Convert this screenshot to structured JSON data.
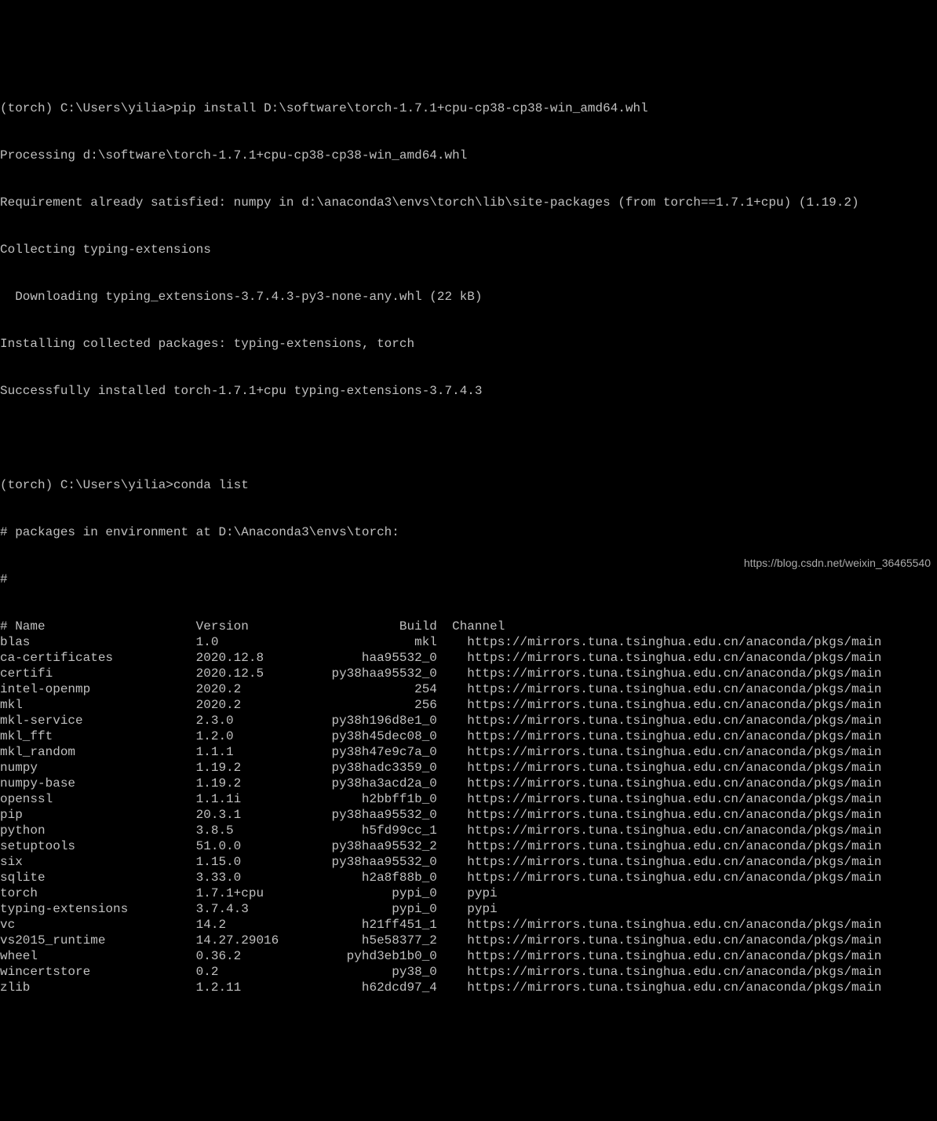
{
  "pip_install": {
    "prompt": "(torch) C:\\Users\\yilia>",
    "command": "pip install D:\\software\\torch-1.7.1+cpu-cp38-cp38-win_amd64.whl",
    "lines": [
      "Processing d:\\software\\torch-1.7.1+cpu-cp38-cp38-win_amd64.whl",
      "Requirement already satisfied: numpy in d:\\anaconda3\\envs\\torch\\lib\\site-packages (from torch==1.7.1+cpu) (1.19.2)",
      "Collecting typing-extensions",
      "  Downloading typing_extensions-3.7.4.3-py3-none-any.whl (22 kB)",
      "Installing collected packages: typing-extensions, torch",
      "Successfully installed torch-1.7.1+cpu typing-extensions-3.7.4.3"
    ]
  },
  "conda_list": {
    "prompt": "(torch) C:\\Users\\yilia>",
    "command": "conda list",
    "header_lines": [
      "# packages in environment at D:\\Anaconda3\\envs\\torch:",
      "#"
    ],
    "columns": {
      "name": "# Name",
      "version": "Version",
      "build": "Build",
      "channel": "Channel"
    },
    "packages": [
      {
        "name": "blas",
        "version": "1.0",
        "build": "mkl",
        "channel": "https://mirrors.tuna.tsinghua.edu.cn/anaconda/pkgs/main"
      },
      {
        "name": "ca-certificates",
        "version": "2020.12.8",
        "build": "haa95532_0",
        "channel": "https://mirrors.tuna.tsinghua.edu.cn/anaconda/pkgs/main"
      },
      {
        "name": "certifi",
        "version": "2020.12.5",
        "build": "py38haa95532_0",
        "channel": "https://mirrors.tuna.tsinghua.edu.cn/anaconda/pkgs/main"
      },
      {
        "name": "intel-openmp",
        "version": "2020.2",
        "build": "254",
        "channel": "https://mirrors.tuna.tsinghua.edu.cn/anaconda/pkgs/main"
      },
      {
        "name": "mkl",
        "version": "2020.2",
        "build": "256",
        "channel": "https://mirrors.tuna.tsinghua.edu.cn/anaconda/pkgs/main"
      },
      {
        "name": "mkl-service",
        "version": "2.3.0",
        "build": "py38h196d8e1_0",
        "channel": "https://mirrors.tuna.tsinghua.edu.cn/anaconda/pkgs/main"
      },
      {
        "name": "mkl_fft",
        "version": "1.2.0",
        "build": "py38h45dec08_0",
        "channel": "https://mirrors.tuna.tsinghua.edu.cn/anaconda/pkgs/main"
      },
      {
        "name": "mkl_random",
        "version": "1.1.1",
        "build": "py38h47e9c7a_0",
        "channel": "https://mirrors.tuna.tsinghua.edu.cn/anaconda/pkgs/main"
      },
      {
        "name": "numpy",
        "version": "1.19.2",
        "build": "py38hadc3359_0",
        "channel": "https://mirrors.tuna.tsinghua.edu.cn/anaconda/pkgs/main"
      },
      {
        "name": "numpy-base",
        "version": "1.19.2",
        "build": "py38ha3acd2a_0",
        "channel": "https://mirrors.tuna.tsinghua.edu.cn/anaconda/pkgs/main"
      },
      {
        "name": "openssl",
        "version": "1.1.1i",
        "build": "h2bbff1b_0",
        "channel": "https://mirrors.tuna.tsinghua.edu.cn/anaconda/pkgs/main"
      },
      {
        "name": "pip",
        "version": "20.3.1",
        "build": "py38haa95532_0",
        "channel": "https://mirrors.tuna.tsinghua.edu.cn/anaconda/pkgs/main"
      },
      {
        "name": "python",
        "version": "3.8.5",
        "build": "h5fd99cc_1",
        "channel": "https://mirrors.tuna.tsinghua.edu.cn/anaconda/pkgs/main"
      },
      {
        "name": "setuptools",
        "version": "51.0.0",
        "build": "py38haa95532_2",
        "channel": "https://mirrors.tuna.tsinghua.edu.cn/anaconda/pkgs/main"
      },
      {
        "name": "six",
        "version": "1.15.0",
        "build": "py38haa95532_0",
        "channel": "https://mirrors.tuna.tsinghua.edu.cn/anaconda/pkgs/main"
      },
      {
        "name": "sqlite",
        "version": "3.33.0",
        "build": "h2a8f88b_0",
        "channel": "https://mirrors.tuna.tsinghua.edu.cn/anaconda/pkgs/main"
      },
      {
        "name": "torch",
        "version": "1.7.1+cpu",
        "build": "pypi_0",
        "channel": "pypi"
      },
      {
        "name": "typing-extensions",
        "version": "3.7.4.3",
        "build": "pypi_0",
        "channel": "pypi"
      },
      {
        "name": "vc",
        "version": "14.2",
        "build": "h21ff451_1",
        "channel": "https://mirrors.tuna.tsinghua.edu.cn/anaconda/pkgs/main"
      },
      {
        "name": "vs2015_runtime",
        "version": "14.27.29016",
        "build": "h5e58377_2",
        "channel": "https://mirrors.tuna.tsinghua.edu.cn/anaconda/pkgs/main"
      },
      {
        "name": "wheel",
        "version": "0.36.2",
        "build": "pyhd3eb1b0_0",
        "channel": "https://mirrors.tuna.tsinghua.edu.cn/anaconda/pkgs/main"
      },
      {
        "name": "wincertstore",
        "version": "0.2",
        "build": "py38_0",
        "channel": "https://mirrors.tuna.tsinghua.edu.cn/anaconda/pkgs/main"
      },
      {
        "name": "zlib",
        "version": "1.2.11",
        "build": "h62dcd97_4",
        "channel": "https://mirrors.tuna.tsinghua.edu.cn/anaconda/pkgs/main"
      }
    ]
  },
  "watermark": "https://blog.csdn.net/weixin_36465540"
}
